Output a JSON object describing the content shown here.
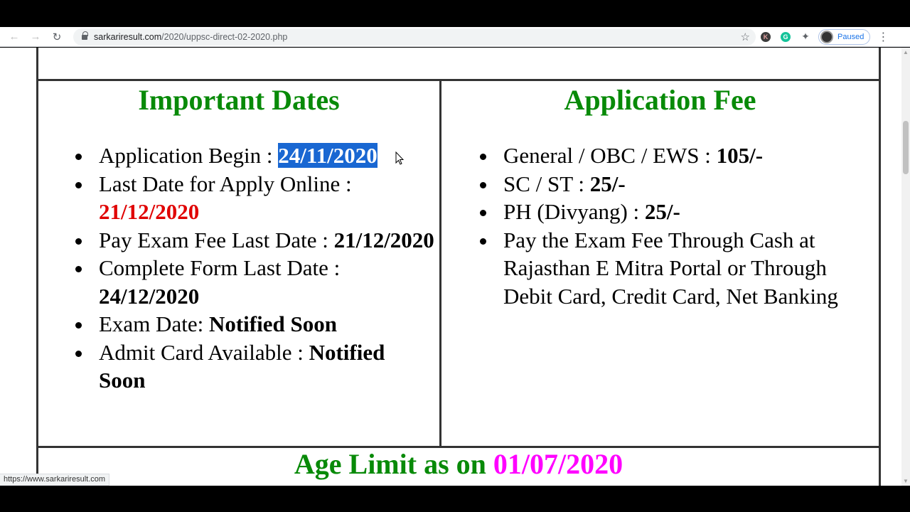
{
  "browser": {
    "url_host": "sarkariresult.com",
    "url_path": "/2020/uppsc-direct-02-2020.php",
    "profile_status": "Paused",
    "status_url": "https://www.sarkariresult.com"
  },
  "important_dates": {
    "title": "Important Dates",
    "items": [
      {
        "label": "Application Begin : ",
        "value": "24/11/2020"
      },
      {
        "label": "Last Date for Apply Online : ",
        "value": "21/12/2020"
      },
      {
        "label": "Pay Exam Fee Last Date : ",
        "value": "21/12/2020"
      },
      {
        "label": "Complete Form Last Date : ",
        "value": "24/12/2020"
      },
      {
        "label": "Exam Date: ",
        "value": "Notified Soon"
      },
      {
        "label": "Admit Card Available : ",
        "value": "Notified Soon"
      }
    ]
  },
  "application_fee": {
    "title": "Application Fee",
    "items": [
      {
        "label": "General / OBC / EWS : ",
        "value": "105/-"
      },
      {
        "label": "SC / ST : ",
        "value": "25/-"
      },
      {
        "label": "PH (Divyang) : ",
        "value": "25/-"
      },
      {
        "label": "Pay the Exam Fee Through Cash at Rajasthan E Mitra Portal or Through Debit Card, Credit Card, Net Banking",
        "value": ""
      }
    ]
  },
  "age_limit": {
    "prefix": "Age Limit as on ",
    "date": "01/07/2020"
  },
  "colors": {
    "heading_green": "#088a08",
    "date_red": "#e00000",
    "age_magenta": "#ff00ff",
    "selection_blue": "#1967d2"
  }
}
